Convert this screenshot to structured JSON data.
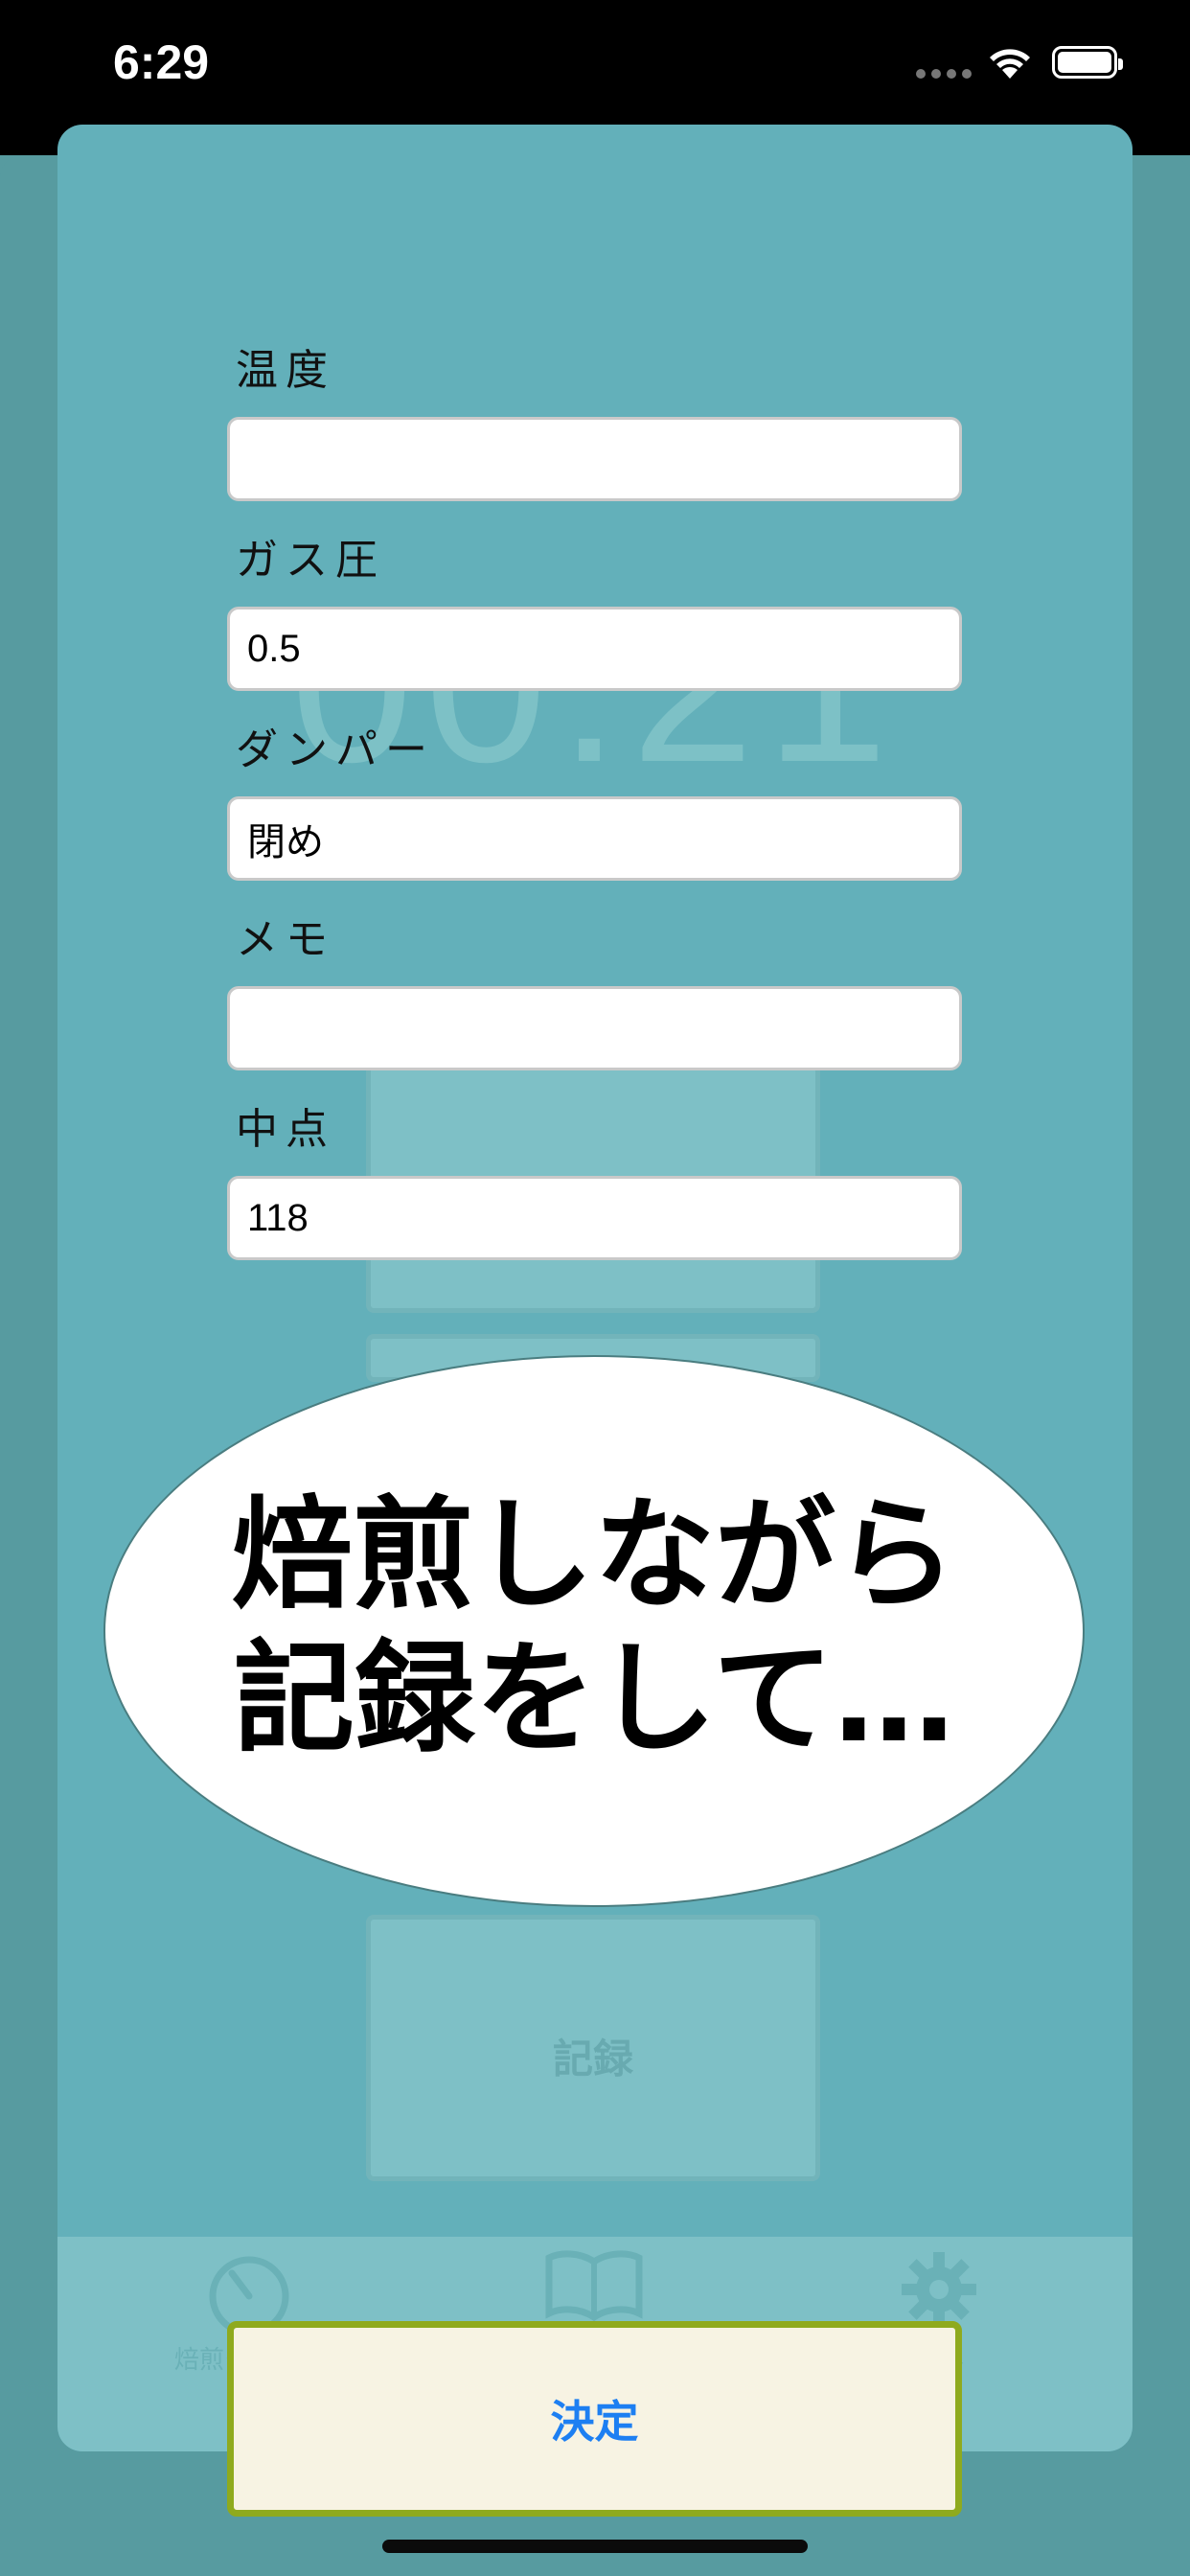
{
  "status_bar": {
    "time": "6:29"
  },
  "background": {
    "timer_display": "00:21",
    "record_button_label": "記録",
    "tabs": [
      {
        "label": "焙煎タイマー",
        "icon": "timer-icon"
      },
      {
        "label": "",
        "icon": "book-icon"
      },
      {
        "label": "設定",
        "icon": "gear-icon"
      }
    ]
  },
  "form": {
    "fields": [
      {
        "label": "温度",
        "value": "",
        "placeholder": ""
      },
      {
        "label": "ガス圧",
        "value": "0.5",
        "placeholder": ""
      },
      {
        "label": "ダンパー",
        "value": "閉め",
        "placeholder": ""
      },
      {
        "label": "メモ",
        "value": "",
        "placeholder": ""
      },
      {
        "label": "中点",
        "value": "118",
        "placeholder": ""
      }
    ],
    "confirm_label": "決定"
  },
  "overlay": {
    "line1": "焙煎しながら",
    "line2": "記録をして…"
  },
  "colors": {
    "background": "#579ba0",
    "sheet": "#63b0ba",
    "accent": "#1d7ff2",
    "button_border": "#8faa1e",
    "button_fill": "#f7f3e3"
  }
}
